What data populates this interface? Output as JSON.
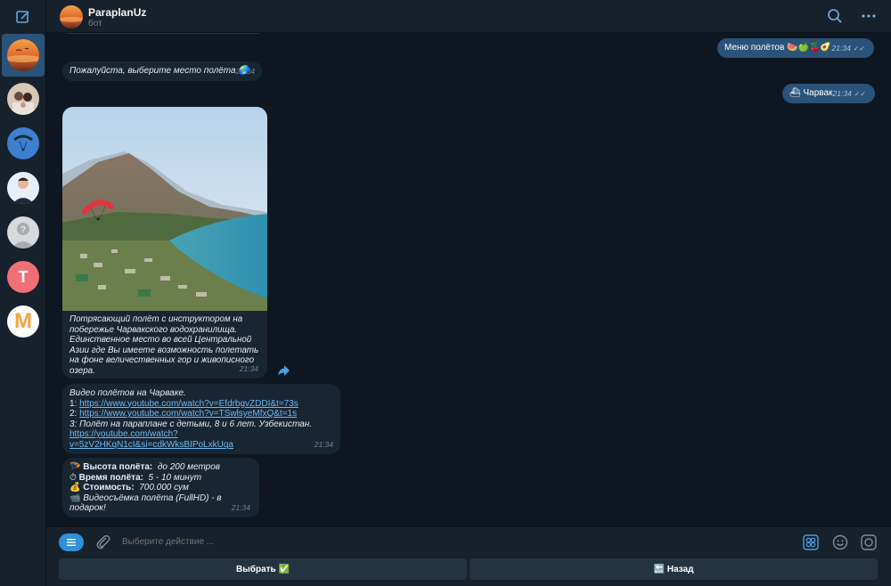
{
  "chat": {
    "name": "ParaplanUz",
    "status": "бот"
  },
  "sidebar": {
    "letter_avatars": [
      {
        "letter": "T",
        "color": "#f06f75"
      },
      {
        "letter": "M",
        "color": "#f7a33e"
      }
    ]
  },
  "messages": {
    "out1": {
      "text": "Меню полётов 🍉🍏🍒🥑",
      "time": "21:34"
    },
    "in1": {
      "text": "Пожалуйста, выберите место полёта 🌏",
      "time": "21:34"
    },
    "out2": {
      "text": "⛴ Чарвак",
      "time": "21:34"
    },
    "photo": {
      "caption": "Потрясающий полёт с инструктором на побережье Чарвакского водохранилища. Единственное место во всей Центральной Азии где Вы имеете возможность полетать на фоне величественных гор и живописного озера.",
      "time": "21:34"
    },
    "videos": {
      "title": "Видео полётов на Чарваке.",
      "l1_prefix": "1: ",
      "l1_url": "https://www.youtube.com/watch?v=EfdrbgvZDDI&t=73s",
      "l2_prefix": "2: ",
      "l2_url": "https://www.youtube.com/watch?v=TSwlsyeMfxQ&t=1s",
      "l3_text": "3: Полёт на параплане с детьми, 8 и 6 лет. Узбекистан.",
      "l3_url": "https://youtube.com/watch?v=5zV2HKqN1cI&si=cdkWksBIPoLxkUqa",
      "time": "21:34"
    },
    "info": {
      "height_label": "Высота полёта:",
      "height_value": "до 200 метров",
      "duration_label": "Время полёта:",
      "duration_value": "5 - 10 минут",
      "price_label": "Стоимость:",
      "price_value": "700.000 сум",
      "video_text": "Видеосъёмка полёта (FullHD) - в подарок!",
      "time": "21:34"
    }
  },
  "composer": {
    "placeholder": "Выберите действие ..."
  },
  "keyboard": {
    "select_label": "Выбрать ✅",
    "back_label": "🔙 Назад"
  },
  "colors": {
    "accent": "#2f8fd9",
    "outgoing": "#2b5278",
    "incoming": "#182533",
    "background": "#0e1621"
  }
}
